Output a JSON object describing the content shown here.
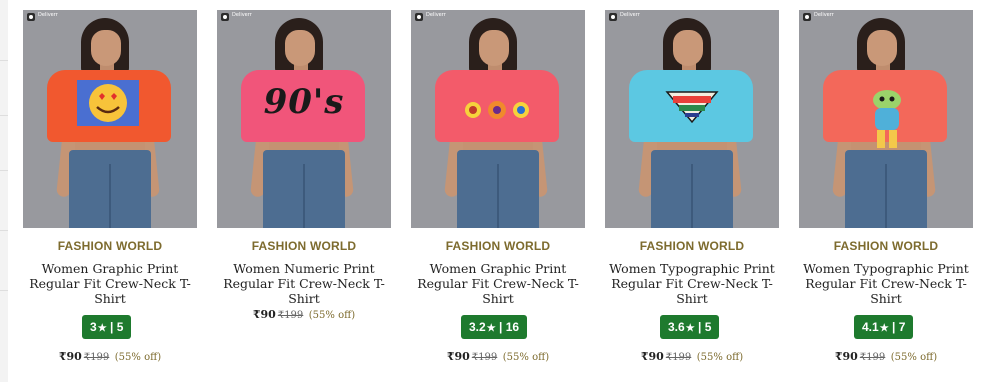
{
  "products": [
    {
      "brand": "FASHION WORLD",
      "title": "Women Graphic Print Regular Fit Crew-Neck T-Shirt",
      "rating_value": "3",
      "rating_count": "5",
      "price": "₹90",
      "mrp": "₹199",
      "discount": "(55% off)",
      "shirt_color": "#f1582f",
      "print": "smiley-heart-eyes"
    },
    {
      "brand": "FASHION WORLD",
      "title": "Women Numeric Print Regular Fit Crew-Neck T-Shirt",
      "rating_value": "",
      "rating_count": "",
      "price": "₹90",
      "mrp": "₹199",
      "discount": "(55% off)",
      "shirt_color": "#f1557a",
      "print_text": "90's"
    },
    {
      "brand": "FASHION WORLD",
      "title": "Women Graphic Print Regular Fit Crew-Neck T-Shirt",
      "rating_value": "3.2",
      "rating_count": "16",
      "price": "₹90",
      "mrp": "₹199",
      "discount": "(55% off)",
      "shirt_color": "#f35b6a",
      "print": "three-eyes"
    },
    {
      "brand": "FASHION WORLD",
      "title": "Women Typographic Print Regular Fit Crew-Neck T-Shirt",
      "rating_value": "3.6",
      "rating_count": "5",
      "price": "₹90",
      "mrp": "₹199",
      "discount": "(55% off)",
      "shirt_color": "#5cc8e2",
      "print": "never-lost"
    },
    {
      "brand": "FASHION WORLD",
      "title": "Women Typographic Print Regular Fit Crew-Neck T-Shirt",
      "rating_value": "4.1",
      "rating_count": "7",
      "price": "₹90",
      "mrp": "₹199",
      "discount": "(55% off)",
      "shirt_color": "#f3685a",
      "print": "cartoon-figure"
    }
  ],
  "badge_label": "Deliverr",
  "star_glyph": "★",
  "rating_separator": "|",
  "colors": {
    "rating_bg": "#1e7a2e",
    "brand_text": "#7d6b2e"
  }
}
